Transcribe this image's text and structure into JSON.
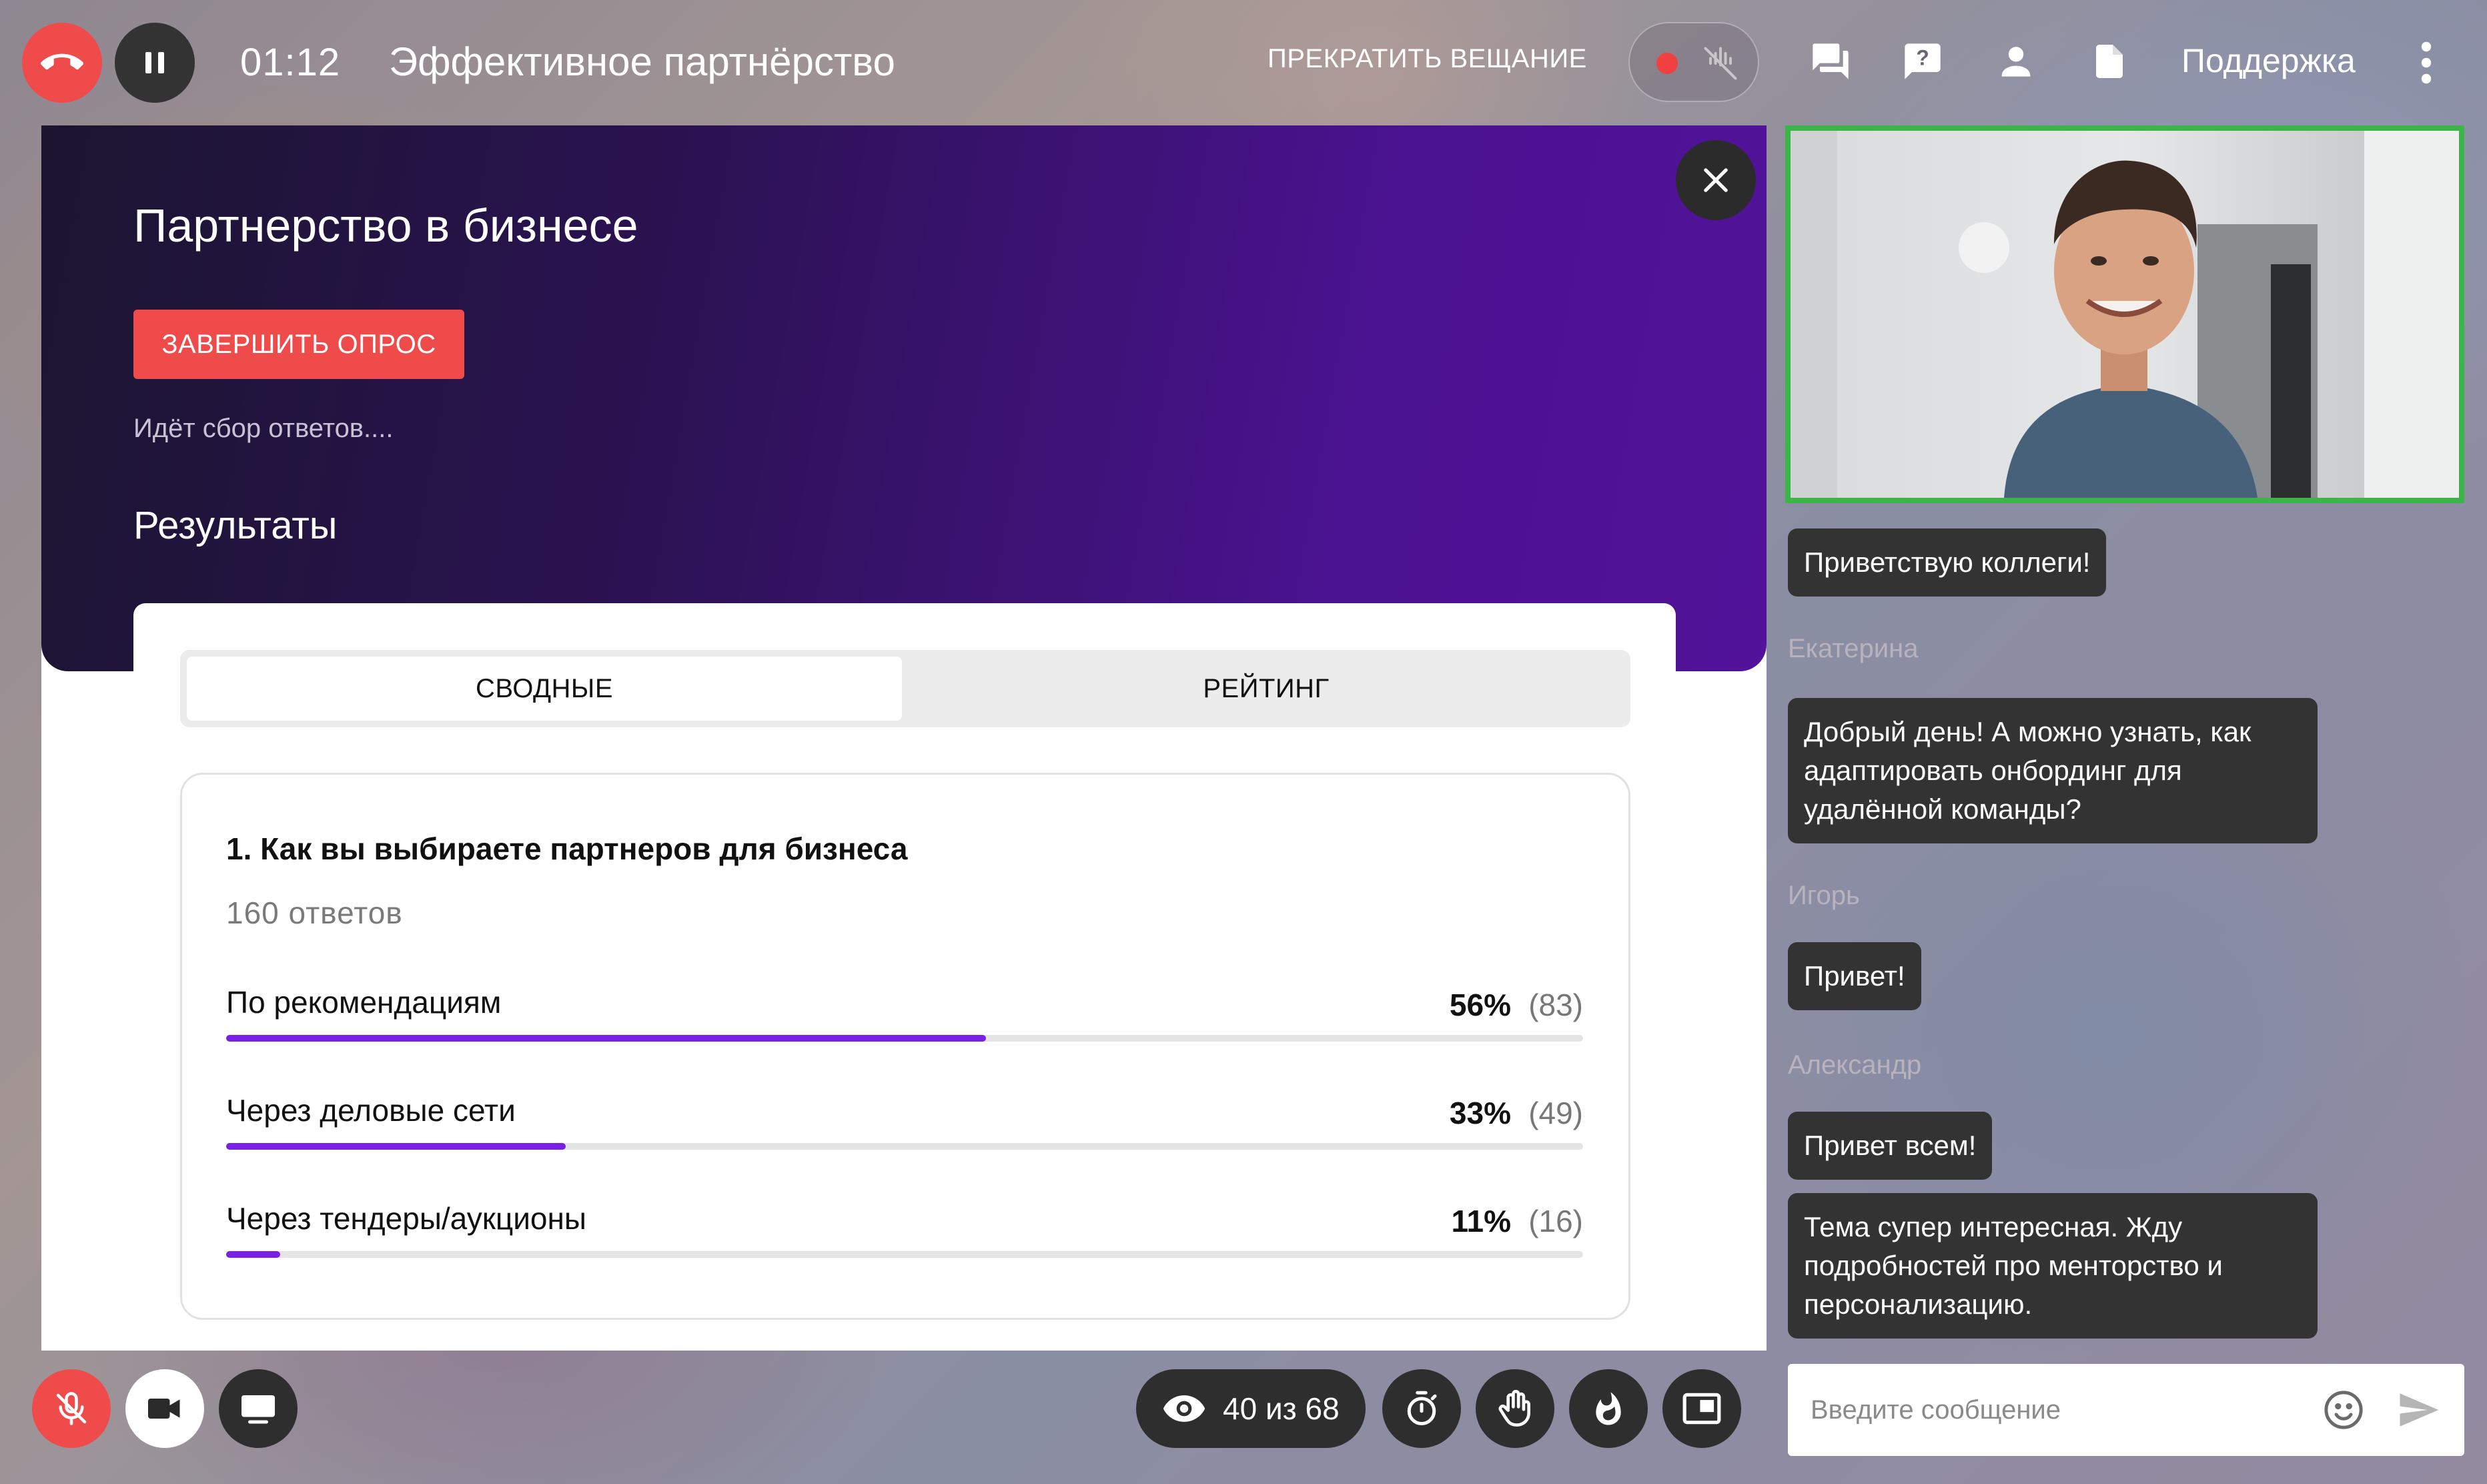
{
  "topbar": {
    "timer": "01:12",
    "stream_title": "Эффективное партнёрство",
    "stop_stream_label": "ПРЕКРАТИТЬ ВЕЩАНИЕ",
    "support_label": "Поддержка",
    "icons": [
      "hangup-icon",
      "pause-icon",
      "record-dot-icon",
      "mic-off-icon",
      "chat-icon",
      "question-icon",
      "user-icon",
      "document-icon",
      "more-vertical-icon"
    ]
  },
  "poll": {
    "title": "Партнерство в бизнесе",
    "finish_label": "ЗАВЕРШИТЬ ОПРОС",
    "status": "Идёт сбор ответов....",
    "results_heading": "Результаты",
    "tabs": [
      {
        "label": "СВОДНЫЕ",
        "active": true
      },
      {
        "label": "РЕЙТИНГ",
        "active": false
      }
    ],
    "question": {
      "title": "1. Как вы выбираете партнеров для бизнеса",
      "responses": "160 ответов",
      "answers": [
        {
          "label": "По рекомендациям",
          "percent": "56%",
          "count": "(83)",
          "fill": 0.56
        },
        {
          "label": "Через деловые сети",
          "percent": "33%",
          "count": "(49)",
          "fill": 0.25
        },
        {
          "label": "Через тендеры/аукционы",
          "percent": "11%",
          "count": "(16)",
          "fill": 0.04
        }
      ]
    }
  },
  "controls": {
    "viewers": "40 из 68",
    "icons": [
      "mic-off-icon",
      "camera-icon",
      "screen-share-icon",
      "eye-icon",
      "timer-icon",
      "raise-hand-icon",
      "fire-icon",
      "picture-in-picture-icon"
    ]
  },
  "chat": {
    "messages": [
      {
        "author": "",
        "text": "Приветствую коллеги!"
      },
      {
        "author": "Екатерина",
        "text": "Добрый день! А можно узнать, как адаптировать онбординг для удалённой команды?"
      },
      {
        "author": "Игорь",
        "text": "Привет!"
      },
      {
        "author": "Александр",
        "text": "Привет всем!"
      },
      {
        "author": "",
        "text": "Тема супер интересная. Жду подробностей про менторство и персонализацию."
      }
    ],
    "input_placeholder": "Введите сообщение"
  },
  "colors": {
    "accent_red": "#f04b4b",
    "accent_purple": "#7a1fe6",
    "video_border_green": "#3cb44a",
    "dark_control": "#2e2e2e"
  }
}
